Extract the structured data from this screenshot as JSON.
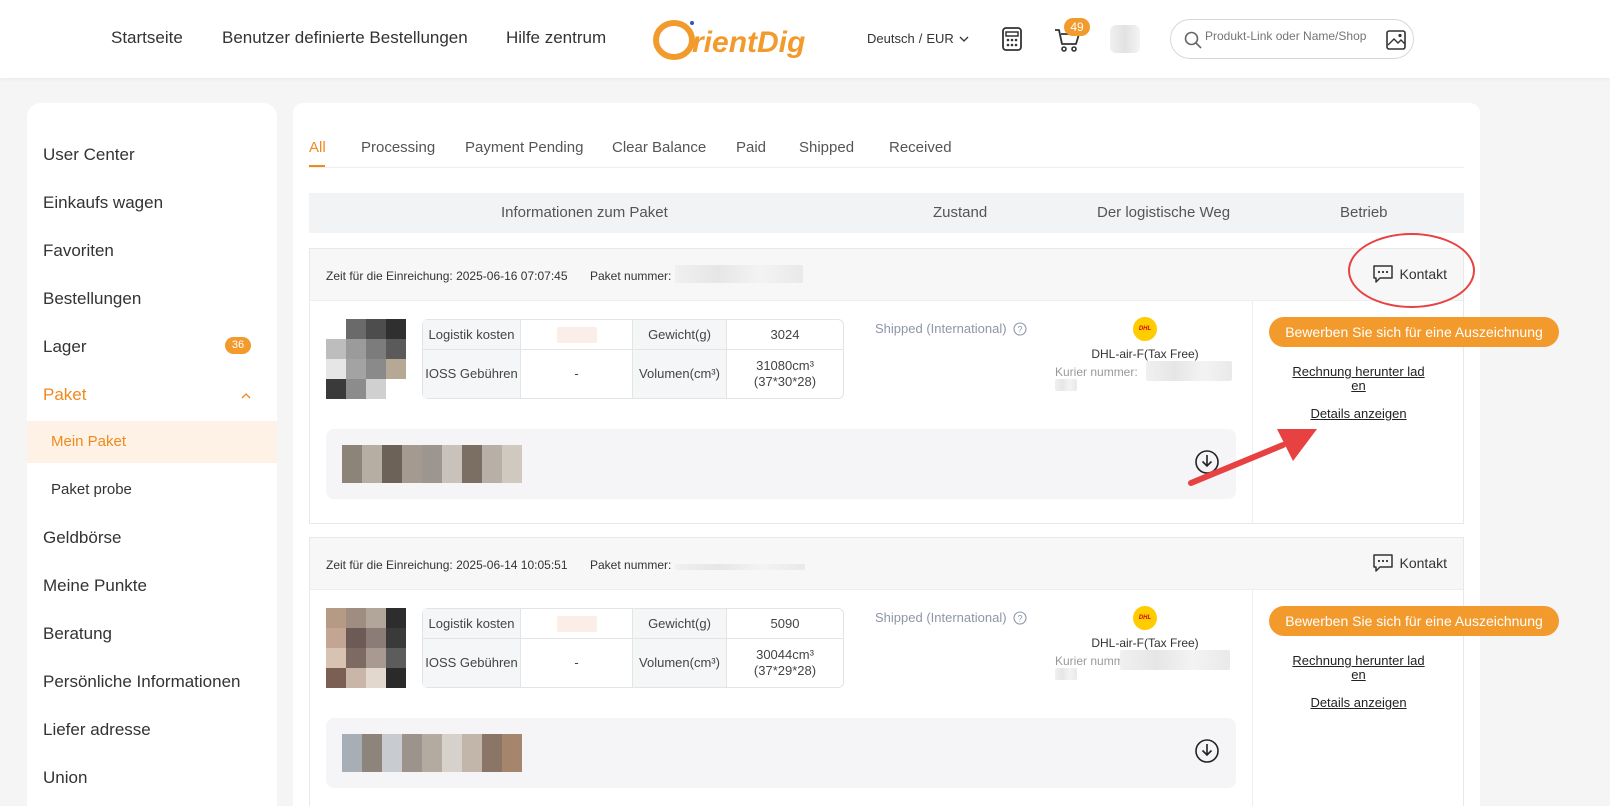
{
  "header": {
    "nav": [
      "Startseite",
      "Benutzer definierte Bestellungen",
      "Hilfe zentrum"
    ],
    "logo_text": "OrientDig",
    "language": "Deutsch",
    "currency": "EUR",
    "cart_count": "49",
    "search_placeholder": "Produkt-Link oder Name/Shop"
  },
  "sidebar": {
    "items": [
      "User Center",
      "Einkaufs wagen",
      "Favoriten",
      "Bestellungen",
      "Lager",
      "Paket",
      "Geldbörse",
      "Meine Punkte",
      "Beratung",
      "Persönliche Informationen",
      "Liefer adresse",
      "Union"
    ],
    "lager_badge": "36",
    "sub_items": [
      "Mein Paket",
      "Paket probe"
    ]
  },
  "tabs": [
    "All",
    "Processing",
    "Payment Pending",
    "Clear Balance",
    "Paid",
    "Shipped",
    "Received"
  ],
  "table_headers": [
    "Informationen zum Paket",
    "Zustand",
    "Der logistische Weg",
    "Betrieb"
  ],
  "labels": {
    "time_prefix": "Zeit für die Einreichung:",
    "package_no": "Paket nummer:",
    "contact": "Kontakt",
    "logistics_cost": "Logistik kosten",
    "weight": "Gewicht(g)",
    "ioss": "IOSS Gebühren",
    "volume": "Volumen(cm³)",
    "courier_no": "Kurier nummer:",
    "apply": "Bewerben Sie sich für eine Auszeichnung",
    "invoice_line1": "Rechnung herunter lad",
    "invoice_line2": "en",
    "details": "Details anzeigen"
  },
  "packages": [
    {
      "time": "2025-06-16 07:07:45",
      "weight": "3024",
      "ioss": "-",
      "volume": "31080cm³",
      "dims": "(37*30*28)",
      "status": "Shipped (International)",
      "carrier": "DHL-air-F(Tax Free)"
    },
    {
      "time": "2025-06-14 10:05:51",
      "weight": "5090",
      "ioss": "-",
      "volume": "30044cm³",
      "dims": "(37*29*28)",
      "status": "Shipped (International)",
      "carrier": "DHL-air-F(Tax Free)"
    }
  ],
  "colors": {
    "accent": "#f0891e",
    "badge": "#f39a2d",
    "annotation": "#e84141"
  }
}
